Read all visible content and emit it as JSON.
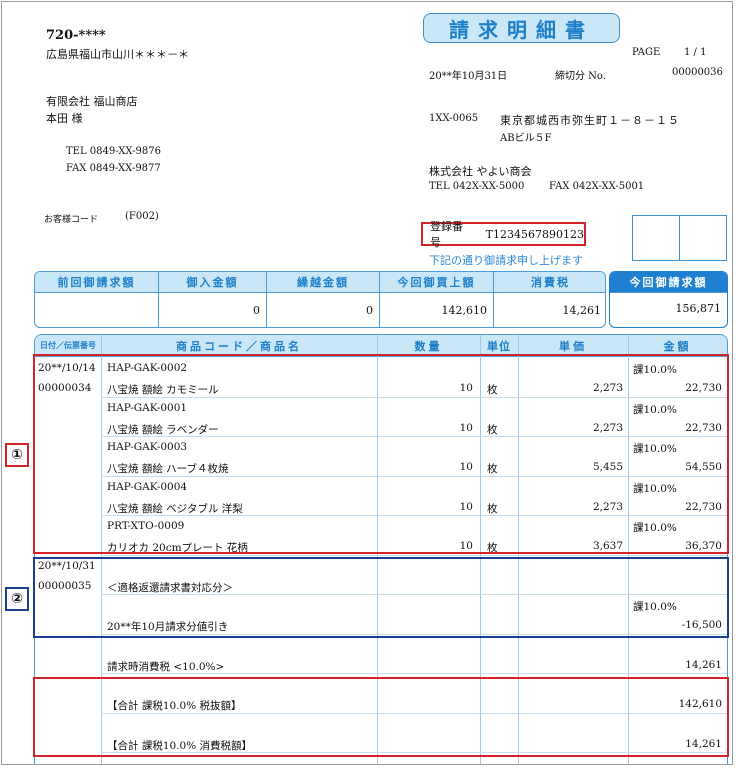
{
  "customer": {
    "postal": "720-****",
    "address": "広島県福山市山川＊＊＊－＊",
    "company": "有限会社 福山商店",
    "contact": "本田 様",
    "tel": "TEL 0849-XX-9876",
    "fax": "FAX 0849-XX-9877",
    "code_label": "お客様コード",
    "code": "(F002)"
  },
  "doc": {
    "title": "請求明細書",
    "page_label": "PAGE",
    "page": "1 / 1",
    "date": "20**年10月31日",
    "closing_label": "締切分 No.",
    "number": "00000036"
  },
  "issuer": {
    "postal": "1XX-0065",
    "address1": "東京都城西市弥生町１－８－１５",
    "address2": "ABビル５F",
    "company": "株式会社 やよい商会",
    "tel": "TEL 042X-XX-5000",
    "fax": "FAX 042X-XX-5001",
    "reg_label": "登録番号",
    "reg_number": "T1234567890123",
    "note": "下記の通り御請求申し上げます"
  },
  "summary": {
    "headers": [
      "前回御請求額",
      "御入金額",
      "繰越金額",
      "今回御買上額",
      "消費税",
      "今回御請求額"
    ],
    "values": [
      "",
      "0",
      "0",
      "142,610",
      "14,261",
      "156,871"
    ]
  },
  "table": {
    "headers": [
      "日付／伝票番号",
      "商品コード／商品名",
      "数量",
      "単位",
      "単価",
      "金額"
    ],
    "rows": [
      {
        "date": "20**/10/14",
        "slip": "00000034",
        "code": "HAP-GAK-0002",
        "name": "八宝焼 額絵 カモミール",
        "qty": "10",
        "unit": "枚",
        "price": "2,273",
        "tax": "課10.0%",
        "amount": "22,730"
      },
      {
        "date": "",
        "slip": "",
        "code": "HAP-GAK-0001",
        "name": "八宝焼 額絵 ラベンダー",
        "qty": "10",
        "unit": "枚",
        "price": "2,273",
        "tax": "課10.0%",
        "amount": "22,730"
      },
      {
        "date": "",
        "slip": "",
        "code": "HAP-GAK-0003",
        "name": "八宝焼 額絵 ハーブ４枚焼",
        "qty": "10",
        "unit": "枚",
        "price": "5,455",
        "tax": "課10.0%",
        "amount": "54,550"
      },
      {
        "date": "",
        "slip": "",
        "code": "HAP-GAK-0004",
        "name": "八宝焼 額絵 ベジタブル 洋梨",
        "qty": "10",
        "unit": "枚",
        "price": "2,273",
        "tax": "課10.0%",
        "amount": "22,730"
      },
      {
        "date": "",
        "slip": "",
        "code": "PRT-XTO-0009",
        "name": "カリオカ 20cmプレート 花柄",
        "qty": "10",
        "unit": "枚",
        "price": "3,637",
        "tax": "課10.0%",
        "amount": "36,370"
      },
      {
        "date": "20**/10/31",
        "slip": "00000035",
        "code": "",
        "name": "＜適格返還請求書対応分＞",
        "qty": "",
        "unit": "",
        "price": "",
        "tax": "",
        "amount": ""
      },
      {
        "date": "",
        "slip": "",
        "code": "",
        "name": "20**年10月請求分値引き",
        "qty": "",
        "unit": "",
        "price": "",
        "tax": "課10.0%",
        "amount": "-16,500"
      },
      {
        "date": "",
        "slip": "",
        "code": "",
        "name": "請求時消費税 <10.0%>",
        "qty": "",
        "unit": "",
        "price": "",
        "tax": "",
        "amount": "14,261"
      },
      {
        "date": "",
        "slip": "",
        "code": "",
        "name": "【合計 課税10.0% 税抜額】",
        "qty": "",
        "unit": "",
        "price": "",
        "tax": "",
        "amount": "142,610"
      },
      {
        "date": "",
        "slip": "",
        "code": "",
        "name": "【合計 課税10.0% 消費税額】",
        "qty": "",
        "unit": "",
        "price": "",
        "tax": "",
        "amount": "14,261"
      }
    ]
  },
  "annotations": {
    "mark1": "①",
    "mark2": "②"
  },
  "colors": {
    "accent": "#1d7fc8",
    "header_bg": "#c9e7f7",
    "highlight_red": "#d3242b",
    "highlight_navy": "#1a3f8c"
  }
}
